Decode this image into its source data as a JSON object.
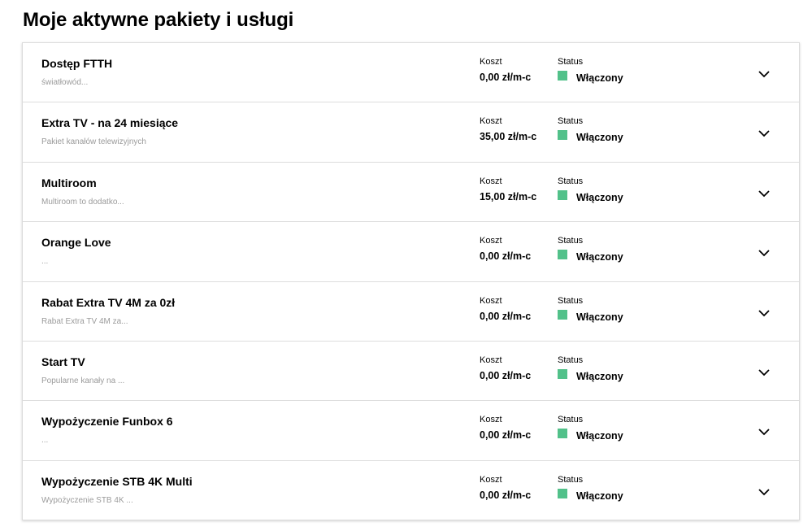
{
  "page": {
    "title": "Moje aktywne pakiety i usługi"
  },
  "colors": {
    "status_on": "#52c18a",
    "divider": "#dddddd",
    "description": "#9b9b9b"
  },
  "labels": {
    "cost": "Koszt",
    "status": "Status"
  },
  "icons": {
    "expand": "chevron-down-icon"
  },
  "services": [
    {
      "name": "Dostęp FTTH",
      "description": "światłowód...",
      "cost": "0,00 zł/m-c",
      "status": "Włączony"
    },
    {
      "name": "Extra TV - na 24 miesiące",
      "description": "Pakiet kanałów telewizyjnych",
      "cost": "35,00 zł/m-c",
      "status": "Włączony"
    },
    {
      "name": "Multiroom",
      "description": "Multiroom to dodatko...",
      "cost": "15,00 zł/m-c",
      "status": "Włączony"
    },
    {
      "name": "Orange Love",
      "description": "...",
      "cost": "0,00 zł/m-c",
      "status": "Włączony"
    },
    {
      "name": "Rabat Extra TV 4M za 0zł",
      "description": "Rabat Extra TV 4M za...",
      "cost": "0,00 zł/m-c",
      "status": "Włączony"
    },
    {
      "name": "Start TV",
      "description": "Popularne kanały na ...",
      "cost": "0,00 zł/m-c",
      "status": "Włączony"
    },
    {
      "name": "Wypożyczenie Funbox 6",
      "description": "...",
      "cost": "0,00 zł/m-c",
      "status": "Włączony"
    },
    {
      "name": "Wypożyczenie STB 4K Multi",
      "description": "Wypożyczenie STB 4K ...",
      "cost": "0,00 zł/m-c",
      "status": "Włączony"
    }
  ]
}
